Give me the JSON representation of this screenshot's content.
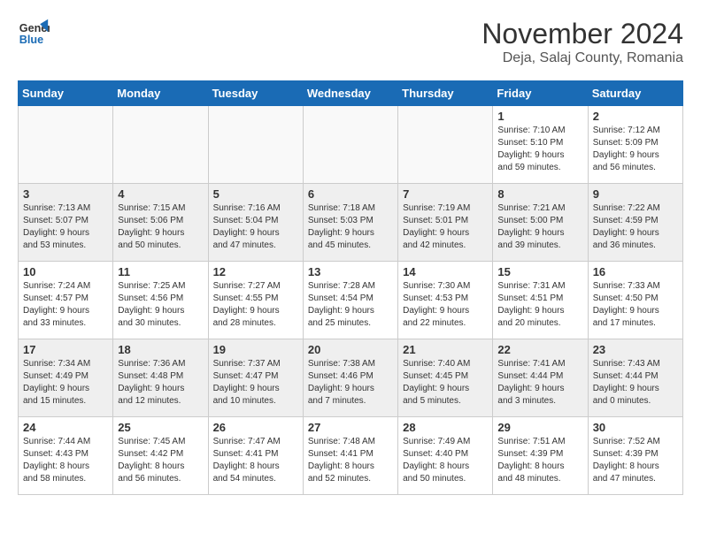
{
  "logo": {
    "line1": "General",
    "line2": "Blue"
  },
  "title": "November 2024",
  "location": "Deja, Salaj County, Romania",
  "weekdays": [
    "Sunday",
    "Monday",
    "Tuesday",
    "Wednesday",
    "Thursday",
    "Friday",
    "Saturday"
  ],
  "weeks": [
    [
      {
        "day": "",
        "text": ""
      },
      {
        "day": "",
        "text": ""
      },
      {
        "day": "",
        "text": ""
      },
      {
        "day": "",
        "text": ""
      },
      {
        "day": "",
        "text": ""
      },
      {
        "day": "1",
        "text": "Sunrise: 7:10 AM\nSunset: 5:10 PM\nDaylight: 9 hours\nand 59 minutes."
      },
      {
        "day": "2",
        "text": "Sunrise: 7:12 AM\nSunset: 5:09 PM\nDaylight: 9 hours\nand 56 minutes."
      }
    ],
    [
      {
        "day": "3",
        "text": "Sunrise: 7:13 AM\nSunset: 5:07 PM\nDaylight: 9 hours\nand 53 minutes."
      },
      {
        "day": "4",
        "text": "Sunrise: 7:15 AM\nSunset: 5:06 PM\nDaylight: 9 hours\nand 50 minutes."
      },
      {
        "day": "5",
        "text": "Sunrise: 7:16 AM\nSunset: 5:04 PM\nDaylight: 9 hours\nand 47 minutes."
      },
      {
        "day": "6",
        "text": "Sunrise: 7:18 AM\nSunset: 5:03 PM\nDaylight: 9 hours\nand 45 minutes."
      },
      {
        "day": "7",
        "text": "Sunrise: 7:19 AM\nSunset: 5:01 PM\nDaylight: 9 hours\nand 42 minutes."
      },
      {
        "day": "8",
        "text": "Sunrise: 7:21 AM\nSunset: 5:00 PM\nDaylight: 9 hours\nand 39 minutes."
      },
      {
        "day": "9",
        "text": "Sunrise: 7:22 AM\nSunset: 4:59 PM\nDaylight: 9 hours\nand 36 minutes."
      }
    ],
    [
      {
        "day": "10",
        "text": "Sunrise: 7:24 AM\nSunset: 4:57 PM\nDaylight: 9 hours\nand 33 minutes."
      },
      {
        "day": "11",
        "text": "Sunrise: 7:25 AM\nSunset: 4:56 PM\nDaylight: 9 hours\nand 30 minutes."
      },
      {
        "day": "12",
        "text": "Sunrise: 7:27 AM\nSunset: 4:55 PM\nDaylight: 9 hours\nand 28 minutes."
      },
      {
        "day": "13",
        "text": "Sunrise: 7:28 AM\nSunset: 4:54 PM\nDaylight: 9 hours\nand 25 minutes."
      },
      {
        "day": "14",
        "text": "Sunrise: 7:30 AM\nSunset: 4:53 PM\nDaylight: 9 hours\nand 22 minutes."
      },
      {
        "day": "15",
        "text": "Sunrise: 7:31 AM\nSunset: 4:51 PM\nDaylight: 9 hours\nand 20 minutes."
      },
      {
        "day": "16",
        "text": "Sunrise: 7:33 AM\nSunset: 4:50 PM\nDaylight: 9 hours\nand 17 minutes."
      }
    ],
    [
      {
        "day": "17",
        "text": "Sunrise: 7:34 AM\nSunset: 4:49 PM\nDaylight: 9 hours\nand 15 minutes."
      },
      {
        "day": "18",
        "text": "Sunrise: 7:36 AM\nSunset: 4:48 PM\nDaylight: 9 hours\nand 12 minutes."
      },
      {
        "day": "19",
        "text": "Sunrise: 7:37 AM\nSunset: 4:47 PM\nDaylight: 9 hours\nand 10 minutes."
      },
      {
        "day": "20",
        "text": "Sunrise: 7:38 AM\nSunset: 4:46 PM\nDaylight: 9 hours\nand 7 minutes."
      },
      {
        "day": "21",
        "text": "Sunrise: 7:40 AM\nSunset: 4:45 PM\nDaylight: 9 hours\nand 5 minutes."
      },
      {
        "day": "22",
        "text": "Sunrise: 7:41 AM\nSunset: 4:44 PM\nDaylight: 9 hours\nand 3 minutes."
      },
      {
        "day": "23",
        "text": "Sunrise: 7:43 AM\nSunset: 4:44 PM\nDaylight: 9 hours\nand 0 minutes."
      }
    ],
    [
      {
        "day": "24",
        "text": "Sunrise: 7:44 AM\nSunset: 4:43 PM\nDaylight: 8 hours\nand 58 minutes."
      },
      {
        "day": "25",
        "text": "Sunrise: 7:45 AM\nSunset: 4:42 PM\nDaylight: 8 hours\nand 56 minutes."
      },
      {
        "day": "26",
        "text": "Sunrise: 7:47 AM\nSunset: 4:41 PM\nDaylight: 8 hours\nand 54 minutes."
      },
      {
        "day": "27",
        "text": "Sunrise: 7:48 AM\nSunset: 4:41 PM\nDaylight: 8 hours\nand 52 minutes."
      },
      {
        "day": "28",
        "text": "Sunrise: 7:49 AM\nSunset: 4:40 PM\nDaylight: 8 hours\nand 50 minutes."
      },
      {
        "day": "29",
        "text": "Sunrise: 7:51 AM\nSunset: 4:39 PM\nDaylight: 8 hours\nand 48 minutes."
      },
      {
        "day": "30",
        "text": "Sunrise: 7:52 AM\nSunset: 4:39 PM\nDaylight: 8 hours\nand 47 minutes."
      }
    ]
  ]
}
